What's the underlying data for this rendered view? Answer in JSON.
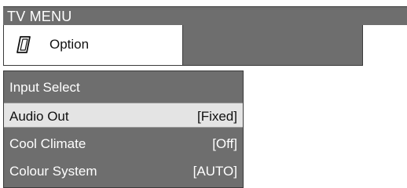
{
  "header": {
    "title": "TV MENU"
  },
  "option_bar": {
    "label": "Option",
    "icon": "option-icon"
  },
  "menu": {
    "items": [
      {
        "label": "Input Select",
        "value": ""
      },
      {
        "label": "Audio Out",
        "value": "[Fixed]",
        "selected": true
      },
      {
        "label": "Cool Climate",
        "value": "[Off]"
      },
      {
        "label": "Colour System",
        "value": "[AUTO]"
      }
    ]
  },
  "colors": {
    "bar_gray": "#6e6e6e",
    "selected_bg": "#e4e4e4",
    "text_light": "#ffffff",
    "text_dark": "#111111"
  }
}
